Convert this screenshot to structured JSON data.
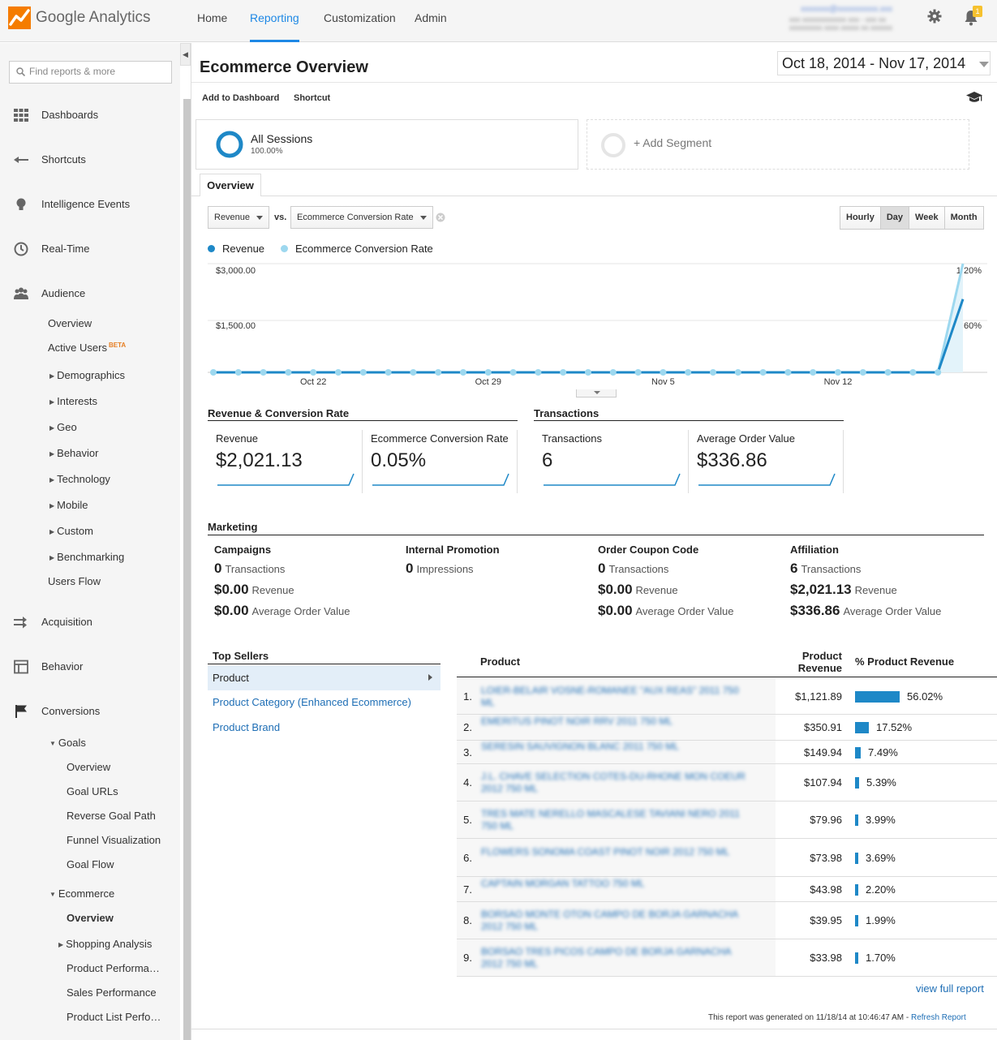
{
  "app": {
    "logo_google": "Google",
    "logo_analytics": "Analytics"
  },
  "topnav": [
    {
      "label": "Home"
    },
    {
      "label": "Reporting"
    },
    {
      "label": "Customization"
    },
    {
      "label": "Admin"
    }
  ],
  "account": {
    "notifications_count": "1"
  },
  "sidebar": {
    "search_placeholder": "Find reports & more",
    "main": {
      "dashboards": "Dashboards",
      "shortcuts": "Shortcuts",
      "intelligence": "Intelligence Events",
      "realtime": "Real-Time",
      "audience": "Audience",
      "acquisition": "Acquisition",
      "behavior": "Behavior",
      "conversions": "Conversions"
    },
    "audience_items": {
      "overview": "Overview",
      "active_users": "Active Users",
      "beta": "BETA",
      "demographics": "Demographics",
      "interests": "Interests",
      "geo": "Geo",
      "behavior": "Behavior",
      "technology": "Technology",
      "mobile": "Mobile",
      "custom": "Custom",
      "benchmarking": "Benchmarking",
      "users_flow": "Users Flow"
    },
    "conversion_items": {
      "goals": "Goals",
      "goals_overview": "Overview",
      "goal_urls": "Goal URLs",
      "reverse_goal_path": "Reverse Goal Path",
      "funnel_visualization": "Funnel Visualization",
      "goal_flow": "Goal Flow",
      "ecommerce": "Ecommerce",
      "ecom_overview": "Overview",
      "shopping_analysis": "Shopping Analysis",
      "product_performance": "Product Performa…",
      "sales_performance": "Sales Performance",
      "product_list": "Product List Perfo…"
    }
  },
  "page": {
    "title": "Ecommerce Overview",
    "date_range": "Oct 18, 2014 - Nov 17, 2014",
    "add_to_dashboard": "Add to Dashboard",
    "shortcut": "Shortcut"
  },
  "segments": {
    "name": "All Sessions",
    "pct": "100.00%",
    "add": "+ Add Segment"
  },
  "tabs": {
    "overview": "Overview"
  },
  "controls": {
    "metric1": "Revenue",
    "vs": "vs.",
    "metric2": "Ecommerce Conversion Rate",
    "granularity": [
      "Hourly",
      "Day",
      "Week",
      "Month"
    ],
    "selected_granularity": "Day"
  },
  "chart_data": {
    "type": "line",
    "series": [
      {
        "name": "Revenue",
        "color": "#1e88c7",
        "axis": "left",
        "values": [
          0,
          0,
          0,
          0,
          0,
          0,
          0,
          0,
          0,
          0,
          0,
          0,
          0,
          0,
          0,
          0,
          0,
          0,
          0,
          0,
          0,
          0,
          0,
          0,
          0,
          0,
          0,
          0,
          0,
          0,
          2021.13
        ]
      },
      {
        "name": "Ecommerce Conversion Rate",
        "color": "#9dd8ef",
        "axis": "right",
        "values": [
          0,
          0,
          0,
          0,
          0,
          0,
          0,
          0,
          0,
          0,
          0,
          0,
          0,
          0,
          0,
          0,
          0,
          0,
          0,
          0,
          0,
          0,
          0,
          0,
          0,
          0,
          0,
          0,
          0,
          0,
          1.2
        ]
      }
    ],
    "x_ticks": [
      "Oct 22",
      "Oct 29",
      "Nov 5",
      "Nov 12"
    ],
    "y_left_ticks": [
      "$3,000.00",
      "$1,500.00"
    ],
    "y_right_ticks": [
      "1.20%",
      "0.60%"
    ],
    "ylim_left": [
      0,
      3000
    ],
    "ylim_right": [
      0,
      1.2
    ],
    "grid": true
  },
  "sections": {
    "revenue_conv": "Revenue & Conversion Rate",
    "transactions": "Transactions",
    "marketing": "Marketing",
    "top_sellers": "Top Sellers"
  },
  "kpis": [
    {
      "name": "Revenue",
      "value": "$2,021.13"
    },
    {
      "name": "Ecommerce Conversion Rate",
      "value": "0.05%"
    },
    {
      "name": "Transactions",
      "value": "6"
    },
    {
      "name": "Average Order Value",
      "value": "$336.86"
    }
  ],
  "marketing": [
    {
      "title": "Campaigns",
      "rows": [
        [
          "0",
          "Transactions"
        ],
        [
          "$0.00",
          "Revenue"
        ],
        [
          "$0.00",
          "Average Order Value"
        ]
      ]
    },
    {
      "title": "Internal Promotion",
      "rows": [
        [
          "0",
          "Impressions"
        ]
      ]
    },
    {
      "title": "Order Coupon Code",
      "rows": [
        [
          "0",
          "Transactions"
        ],
        [
          "$0.00",
          "Revenue"
        ],
        [
          "$0.00",
          "Average Order Value"
        ]
      ]
    },
    {
      "title": "Affiliation",
      "rows": [
        [
          "6",
          "Transactions"
        ],
        [
          "$2,021.13",
          "Revenue"
        ],
        [
          "$336.86",
          "Average Order Value"
        ]
      ]
    }
  ],
  "top_sellers": {
    "items": [
      "Product",
      "Product Category (Enhanced Ecommerce)",
      "Product Brand"
    ]
  },
  "products": {
    "col_product": "Product",
    "col_revenue": "Product Revenue",
    "col_pct": "% Product Revenue",
    "rows": [
      {
        "idx": "1.",
        "name": "LOIER-BELAIR VOSNE-ROMANEE \"AUX REAS\" 2011 750 ML",
        "revenue": "$1,121.89",
        "pct": "56.02%",
        "share": 0.5602
      },
      {
        "idx": "2.",
        "name": "EMERITUS PINOT NOIR RRV 2011 750 ML",
        "revenue": "$350.91",
        "pct": "17.52%",
        "share": 0.1752
      },
      {
        "idx": "3.",
        "name": "SERESIN SAUVIGNON BLANC 2011 750 ML",
        "revenue": "$149.94",
        "pct": "7.49%",
        "share": 0.0749
      },
      {
        "idx": "4.",
        "name": "J.L. CHAVE SELECTION COTES-DU-RHONE MON COEUR 2012 750 ML",
        "revenue": "$107.94",
        "pct": "5.39%",
        "share": 0.0539
      },
      {
        "idx": "5.",
        "name": "TRES MATE NERELLO MASCALESE TAVIANI NERO 2011 750 ML",
        "revenue": "$79.96",
        "pct": "3.99%",
        "share": 0.0399
      },
      {
        "idx": "6.",
        "name": "FLOWERS SONOMA COAST PINOT NOIR 2012 750 ML",
        "revenue": "$73.98",
        "pct": "3.69%",
        "share": 0.0369
      },
      {
        "idx": "7.",
        "name": "CAPTAIN MORGAN TATTOO 750 ML",
        "revenue": "$43.98",
        "pct": "2.20%",
        "share": 0.022
      },
      {
        "idx": "8.",
        "name": "BORSAO MONTE OTON CAMPO DE BORJA GARNACHA 2012 750 ML",
        "revenue": "$39.95",
        "pct": "1.99%",
        "share": 0.0199
      },
      {
        "idx": "9.",
        "name": "BORSAO TRES PICOS CAMPO DE BORJA GARNACHA 2012 750 ML",
        "revenue": "$33.98",
        "pct": "1.70%",
        "share": 0.017
      }
    ]
  },
  "footer": {
    "view_full": "view full report",
    "generated": "This report was generated on 11/18/14 at 10:46:47 AM - ",
    "refresh": "Refresh Report"
  }
}
